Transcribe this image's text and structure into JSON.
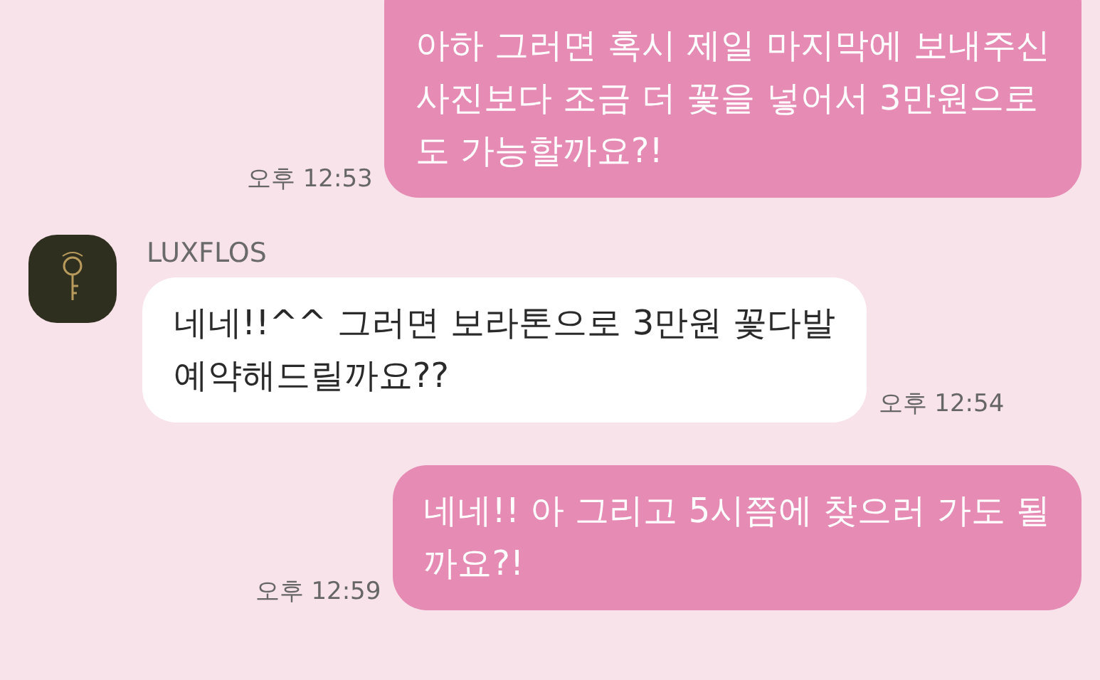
{
  "messages": [
    {
      "kind": "sent",
      "lines": [
        "아하 그러면 혹시 제일 마지막에 보내주신",
        "사진보다 조금 더 꽃을 넣어서 3만원으로",
        "도 가능할까요?!"
      ],
      "time": "오후 12:53"
    },
    {
      "kind": "received",
      "sender": "LUXFLOS",
      "lines": [
        "네네!!^^ 그러면 보라톤으로 3만원 꽃다발",
        "예약해드릴까요??"
      ],
      "time": "오후 12:54"
    },
    {
      "kind": "sent",
      "lines": [
        "네네!! 아 그리고 5시쯤에 찾으러 가도 될",
        "까요?!"
      ],
      "time": "오후 12:59"
    }
  ]
}
